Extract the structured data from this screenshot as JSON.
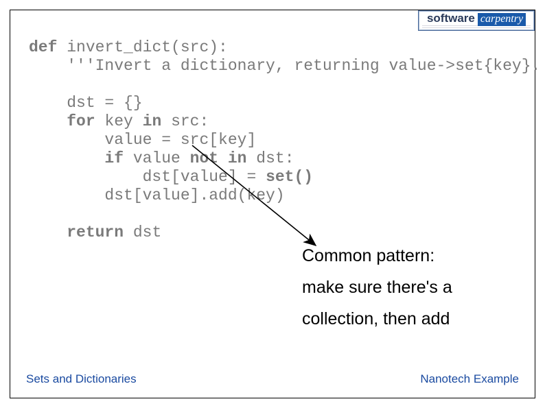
{
  "logo": {
    "word1": "software",
    "word2": "carpentry"
  },
  "code": {
    "l1a": "def",
    "l1b": " invert_dict(src):",
    "l2": "    '''Invert a dictionary, returning value->set{key}.",
    "l3": "",
    "l4": "    dst = {}",
    "l5a": "    ",
    "l5b": "for",
    "l5c": " key ",
    "l5d": "in",
    "l5e": " src:",
    "l6": "        value = src[key]",
    "l7a": "        ",
    "l7b": "if",
    "l7c": " value ",
    "l7d": "not in",
    "l7e": " dst:",
    "l8a": "            dst[value] = ",
    "l8b": "set()",
    "l9": "        dst[value].add(key)",
    "l10": "",
    "l11a": "    ",
    "l11b": "return",
    "l11c": " dst"
  },
  "annotation": {
    "line1": "Common pattern:",
    "line2": "make sure there's a",
    "line3": "collection, then add"
  },
  "footer": {
    "left": "Sets and Dictionaries",
    "right": "Nanotech Example"
  }
}
